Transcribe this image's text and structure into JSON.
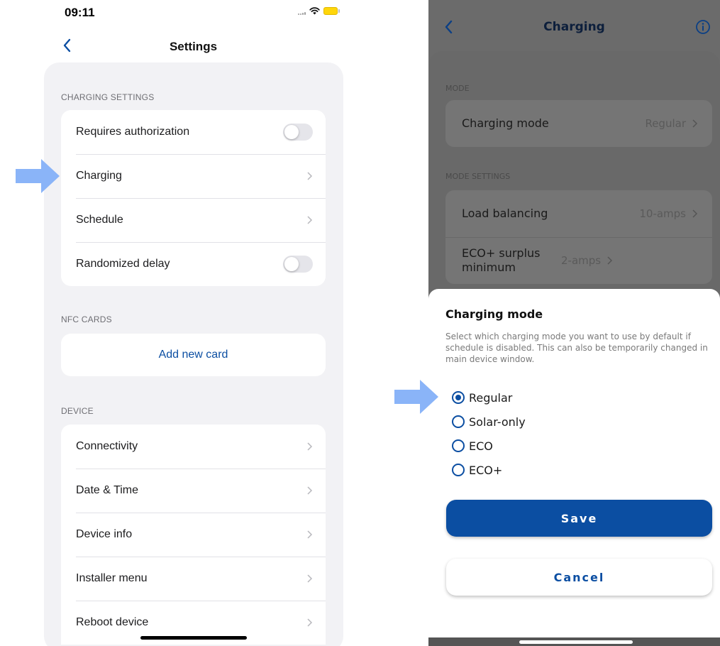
{
  "settings_screen": {
    "status_time": "09:11",
    "title": "Settings",
    "sections": {
      "charging_settings": {
        "label": "CHARGING SETTINGS",
        "rows": [
          {
            "label": "Requires authorization",
            "control": "toggle",
            "on": false
          },
          {
            "label": "Charging",
            "control": "chevron"
          },
          {
            "label": "Schedule",
            "control": "chevron"
          },
          {
            "label": "Randomized delay",
            "control": "toggle",
            "on": false
          }
        ]
      },
      "nfc_cards": {
        "label": "NFC CARDS",
        "add_card_label": "Add new card"
      },
      "device": {
        "label": "DEVICE",
        "rows": [
          {
            "label": "Connectivity"
          },
          {
            "label": "Date & Time"
          },
          {
            "label": "Device info"
          },
          {
            "label": "Installer menu"
          },
          {
            "label": "Reboot device"
          }
        ]
      }
    }
  },
  "charging_screen": {
    "title": "Charging",
    "mode_section_label": "MODE",
    "mode_row": {
      "label": "Charging mode",
      "value": "Regular"
    },
    "mode_settings_label": "MODE SETTINGS",
    "mode_settings_rows": [
      {
        "label": "Load balancing",
        "value": "10-amps"
      },
      {
        "label": "ECO+ surplus minimum",
        "value": "2-amps"
      }
    ],
    "sheet": {
      "title": "Charging mode",
      "description": "Select which charging mode you want to use by default if schedule is disabled. This can also be temporarily changed in main device window.",
      "options": [
        {
          "label": "Regular",
          "selected": true
        },
        {
          "label": "Solar-only",
          "selected": false
        },
        {
          "label": "ECO",
          "selected": false
        },
        {
          "label": "ECO+",
          "selected": false
        }
      ],
      "save_label": "Save",
      "cancel_label": "Cancel"
    }
  },
  "colors": {
    "accent": "#0b4ea2",
    "annotation_arrow": "#8ab4f8",
    "overlay_dim": "#6b6b6b"
  }
}
